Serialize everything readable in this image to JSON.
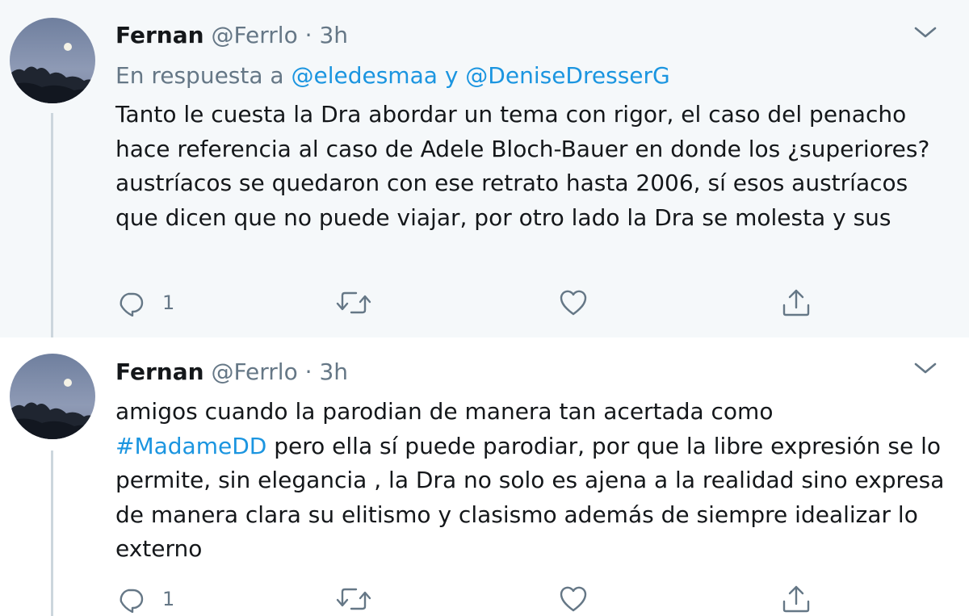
{
  "tweets": [
    {
      "name": "Fernan",
      "handle": "@Ferrlo",
      "separator": "·",
      "time": "3h",
      "reply_prefix": "En respuesta a",
      "reply_mention_1": "@eledesmaa",
      "reply_conjunction": "y",
      "reply_mention_2": "@DeniseDresserG",
      "text": "Tanto le cuesta la Dra abordar un tema con rigor, el caso del penacho hace referencia al caso de Adele Bloch-Bauer en donde los ¿superiores? austríacos se quedaron con ese retrato hasta 2006, sí esos austríacos que dicen que no puede viajar, por otro lado la Dra se molesta y sus",
      "reply_count": "1",
      "icons": {
        "reply": "reply-icon",
        "retweet": "retweet-icon",
        "like": "heart-icon",
        "share": "share-icon",
        "menu": "chevron-down-icon"
      }
    },
    {
      "name": "Fernan",
      "handle": "@Ferrlo",
      "separator": "·",
      "time": "3h",
      "text_before": "amigos cuando la parodian de manera tan acertada como",
      "hashtag": "#MadameDD",
      "text_after": "pero ella sí puede parodiar, por que la libre expresión se lo permite, sin elegancia , la Dra no solo es ajena a la realidad sino expresa de manera clara su elitismo y clasismo además de siempre idealizar lo externo",
      "reply_count": "1",
      "icons": {
        "reply": "reply-icon",
        "retweet": "retweet-icon",
        "like": "heart-icon",
        "share": "share-icon",
        "menu": "chevron-down-icon"
      }
    }
  ],
  "colors": {
    "link": "#1b95e0",
    "secondary_text": "#657786",
    "primary_text": "#14171a",
    "highlight_bg": "#f5f8fa",
    "thread_line": "#ccd6dd"
  }
}
